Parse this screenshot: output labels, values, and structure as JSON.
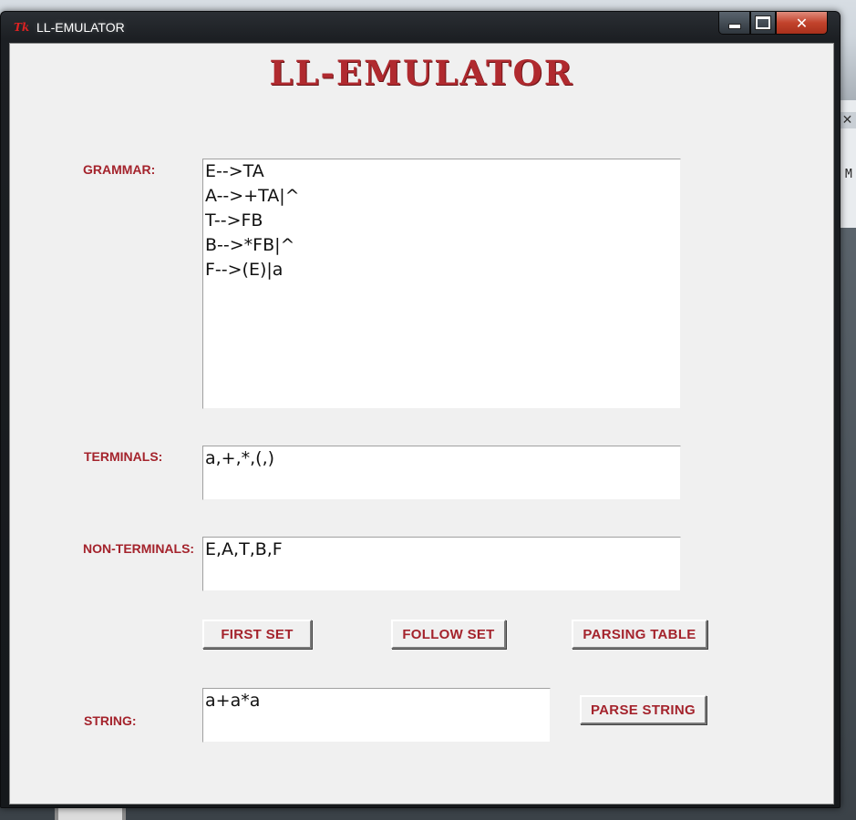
{
  "window": {
    "title": "LL-EMULATOR",
    "icon": "tk-feather-icon",
    "controls": {
      "minimize": "minimize-icon",
      "maximize": "maximize-icon",
      "close_label": "✕"
    }
  },
  "app": {
    "heading": "LL-EMULATOR"
  },
  "form": {
    "grammar": {
      "label": "GRAMMAR:",
      "value": "E-->TA\nA-->+TA|^\nT-->FB\nB-->*FB|^\nF-->(E)|a"
    },
    "terminals": {
      "label": "TERMINALS:",
      "value": "a,+,*,(,)"
    },
    "non_terminals": {
      "label": "NON-TERMINALS:",
      "value": "E,A,T,B,F"
    },
    "string": {
      "label": "STRING:",
      "value": "a+a*a"
    }
  },
  "buttons": {
    "first_set": "FIRST SET",
    "follow_set": "FOLLOW SET",
    "parsing_table": "PARSING TABLE",
    "parse_string": "PARSE STRING"
  },
  "background": {
    "close_glyph": "✕",
    "partial_text": "M"
  },
  "colors": {
    "accent_label": "#a4232c",
    "heading": "#b02a2f",
    "close_button": "#c2432c",
    "client_bg": "#f0f0f0"
  }
}
